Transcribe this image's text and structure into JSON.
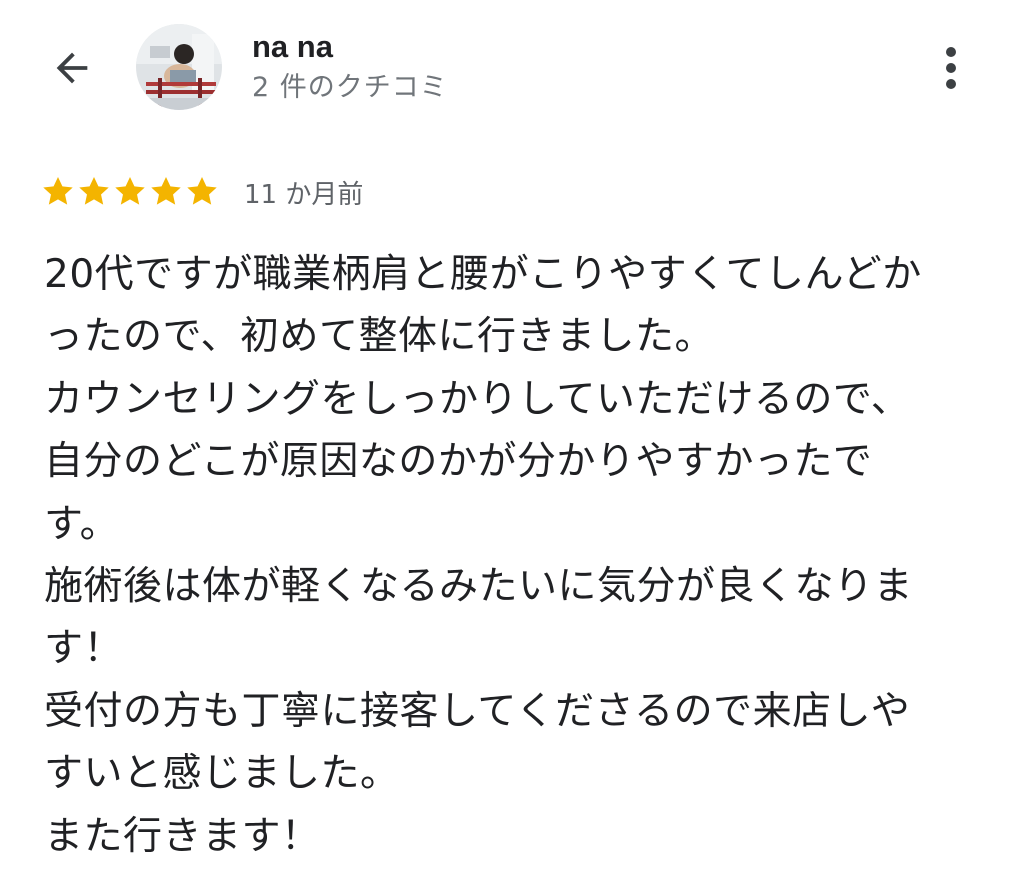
{
  "header": {
    "back_icon": "arrow-back-icon",
    "avatar_icon": "profile-photo",
    "user_name": "na na",
    "review_count": "2 件のクチコミ",
    "more_icon": "more-vert-icon"
  },
  "review": {
    "rating": 5,
    "rating_max": 5,
    "star_color": "#f4b400",
    "date": "11 か月前",
    "lines": [
      "20代ですが職業柄肩と腰がこりやすくてしんどか",
      "ったので、初めて整体に行きました。",
      "カウンセリングをしっかりしていただけるので、",
      "自分のどこが原因なのかが分かりやすかったで",
      "す。",
      "施術後は体が軽くなるみたいに気分が良くなりま",
      "す！",
      "受付の方も丁寧に接客してくださるので来店しや",
      "すいと感じました。",
      "また行きます！"
    ]
  }
}
